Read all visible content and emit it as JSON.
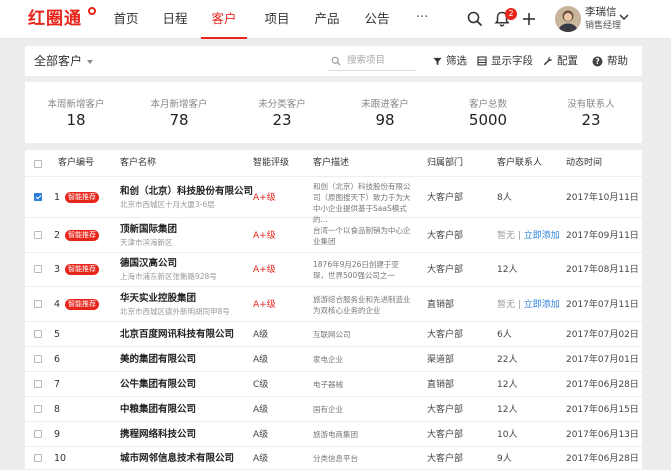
{
  "logo": {
    "text": "红圈通"
  },
  "nav": {
    "items": [
      {
        "label": "首页",
        "active": false
      },
      {
        "label": "日程",
        "active": false
      },
      {
        "label": "客户",
        "active": true
      },
      {
        "label": "项目",
        "active": false
      },
      {
        "label": "产品",
        "active": false
      },
      {
        "label": "公告",
        "active": false
      }
    ],
    "more": "···"
  },
  "header": {
    "notifications_count": "2",
    "user_name": "李瑞信",
    "user_role": "销售经理"
  },
  "toolbar": {
    "view_label": "全部客户",
    "search_placeholder": "搜索项目",
    "filter_label": "筛选",
    "fields_label": "显示字段",
    "config_label": "配置",
    "help_label": "帮助"
  },
  "stats": [
    {
      "label": "本周新增客户",
      "value": "18"
    },
    {
      "label": "本月新增客户",
      "value": "78"
    },
    {
      "label": "未分类客户",
      "value": "23"
    },
    {
      "label": "未跟进客户",
      "value": "98"
    },
    {
      "label": "客户总数",
      "value": "5000"
    },
    {
      "label": "没有联系人",
      "value": "23"
    }
  ],
  "table": {
    "headers": {
      "code": "客户编号",
      "name": "客户名称",
      "rating": "智能评级",
      "desc": "客户描述",
      "dept": "归属部门",
      "contacts": "客户联系人",
      "time": "动态时间"
    },
    "rows": [
      {
        "checked": true,
        "num": "1",
        "tag": "智能推荐",
        "name": "和创（北京）科技股份有限公司",
        "sub": "北京市西城区十月大厦3-6层",
        "rating": "A+级",
        "desc": "和创（北京）科技股份有限公司（原图搜天下）致力于为大中小企业提供基于SaaS模式的...",
        "dept": "大客户部",
        "contacts": "8人",
        "add_link": "",
        "time": "2017年10月11日"
      },
      {
        "checked": false,
        "num": "2",
        "tag": "智能推荐",
        "name": "顶新国际集团",
        "sub": "天津市滨海新区",
        "rating": "A+级",
        "desc": "台湾一个以食品制销为中心企业集团",
        "dept": "大客户部",
        "contacts": "暂无",
        "add_link": "立即添加",
        "time": "2017年09月11日"
      },
      {
        "checked": false,
        "num": "3",
        "tag": "智能推荐",
        "name": "德国汉高公司",
        "sub": "上海市浦东新区张衡路928号",
        "rating": "A+级",
        "desc": "1876年9月26日创建于亚琛，世界500强公司之一",
        "dept": "大客户部",
        "contacts": "12人",
        "add_link": "",
        "time": "2017年08月11日"
      },
      {
        "checked": false,
        "num": "4",
        "tag": "智能推荐",
        "name": "华天实业控股集团",
        "sub": "北京市西城区德外新明胡同甲8号",
        "rating": "A+级",
        "desc": "旅游综合服务业和先进制造业为双核心业务的企业",
        "dept": "直销部",
        "contacts": "暂无",
        "add_link": "立即添加",
        "time": "2017年07月11日"
      },
      {
        "checked": false,
        "num": "5",
        "tag": "",
        "name": "北京百度网讯科技有限公司",
        "sub": "",
        "rating": "A级",
        "desc": "互联网公司",
        "dept": "大客户部",
        "contacts": "6人",
        "add_link": "",
        "time": "2017年07月02日"
      },
      {
        "checked": false,
        "num": "6",
        "tag": "",
        "name": "美的集团有限公司",
        "sub": "",
        "rating": "A级",
        "desc": "家电企业",
        "dept": "渠道部",
        "contacts": "22人",
        "add_link": "",
        "time": "2017年07月01日"
      },
      {
        "checked": false,
        "num": "7",
        "tag": "",
        "name": "公牛集团有限公司",
        "sub": "",
        "rating": "C级",
        "desc": "电子器械",
        "dept": "直销部",
        "contacts": "12人",
        "add_link": "",
        "time": "2017年06月28日"
      },
      {
        "checked": false,
        "num": "8",
        "tag": "",
        "name": "中粮集团有限公司",
        "sub": "",
        "rating": "A级",
        "desc": "国有企业",
        "dept": "大客户部",
        "contacts": "12人",
        "add_link": "",
        "time": "2017年06月15日"
      },
      {
        "checked": false,
        "num": "9",
        "tag": "",
        "name": "携程网络科技公司",
        "sub": "",
        "rating": "A级",
        "desc": "旅游电商集团",
        "dept": "大客户部",
        "contacts": "10人",
        "add_link": "",
        "time": "2017年06月13日"
      },
      {
        "checked": false,
        "num": "10",
        "tag": "",
        "name": "城市网邻信息技术有限公司",
        "sub": "",
        "rating": "A级",
        "desc": "分类信息平台",
        "dept": "大客户部",
        "contacts": "9人",
        "add_link": "",
        "time": "2017年06月28日"
      }
    ]
  },
  "colors": {
    "accent": "#e8251b",
    "link": "#2b7fd9",
    "background": "#ededed"
  }
}
